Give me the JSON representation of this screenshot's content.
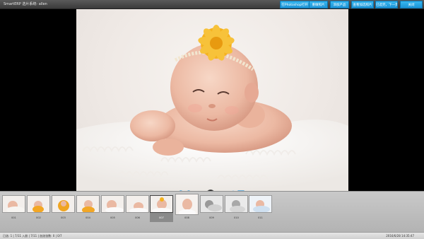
{
  "window": {
    "title": "SmartERP 选片系统- allen"
  },
  "toolbar": {
    "buttons": [
      {
        "label": "在Photoshop打开"
      },
      {
        "label": "重做照片"
      },
      {
        "label": "添加产品"
      },
      {
        "label": "查看加选照片"
      },
      {
        "label": "已选完，下一步"
      },
      {
        "label": "关闭"
      }
    ],
    "accent": "#22a4e6"
  },
  "thumbnails": [
    {
      "label": "001",
      "selected": false
    },
    {
      "label": "002",
      "selected": false
    },
    {
      "label": "003",
      "selected": false
    },
    {
      "label": "004",
      "selected": false
    },
    {
      "label": "005",
      "selected": false
    },
    {
      "label": "006",
      "selected": false
    },
    {
      "label": "007",
      "selected": true
    },
    {
      "label": "008",
      "selected": false
    },
    {
      "label": "009",
      "selected": false
    },
    {
      "label": "010",
      "selected": false
    },
    {
      "label": "011",
      "selected": false
    }
  ],
  "status": {
    "left": "已选: 1 | 7/11 入册 | 7/11 | 加选张数: 0 | 0/7",
    "right": "2016/6/28 14:35:47"
  }
}
